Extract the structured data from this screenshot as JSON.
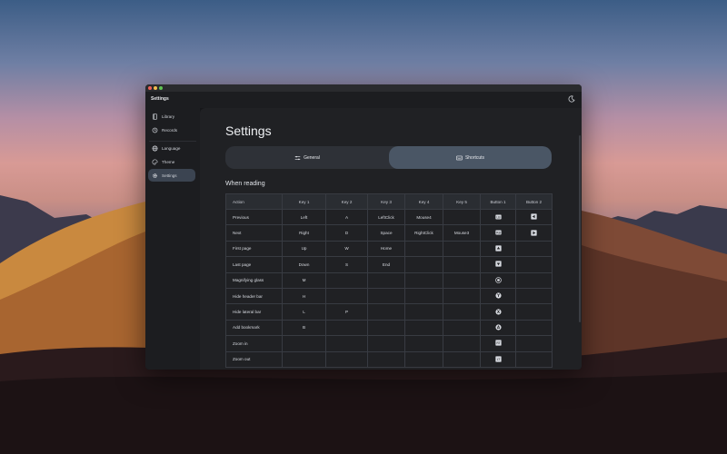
{
  "window": {
    "app_title": "Settings"
  },
  "sidebar": {
    "items": [
      {
        "label": "Library",
        "icon": "book-icon"
      },
      {
        "label": "Records",
        "icon": "history-icon"
      },
      {
        "label": "Language",
        "icon": "globe-icon"
      },
      {
        "label": "Theme",
        "icon": "palette-icon"
      },
      {
        "label": "Settings",
        "icon": "gear-icon",
        "active": true
      }
    ]
  },
  "main": {
    "page_title": "Settings",
    "tabs": [
      {
        "label": "General",
        "icon": "sliders-icon"
      },
      {
        "label": "Shortcuts",
        "icon": "keyboard-icon",
        "active": true
      }
    ],
    "section_title": "When reading",
    "table": {
      "headers": [
        "Action",
        "Key 1",
        "Key 2",
        "Key 3",
        "Key 4",
        "Key 5",
        "Button 1",
        "Button 2"
      ],
      "rows": [
        {
          "action": "Previous",
          "key1": "Left",
          "key2": "A",
          "key3": "LeftClick",
          "key4": "Mouse4",
          "key5": "",
          "button1": "LB",
          "button2": "dpad-left"
        },
        {
          "action": "Next",
          "key1": "Right",
          "key2": "D",
          "key3": "Space",
          "key4": "RightClick",
          "key5": "Mouse3",
          "button1": "RB",
          "button2": "dpad-right"
        },
        {
          "action": "First page",
          "key1": "Up",
          "key2": "W",
          "key3": "Home",
          "key4": "",
          "key5": "",
          "button1": "dpad-up",
          "button2": ""
        },
        {
          "action": "Last page",
          "key1": "Down",
          "key2": "S",
          "key3": "End",
          "key4": "",
          "key5": "",
          "button1": "dpad-down",
          "button2": ""
        },
        {
          "action": "Magnifying glass",
          "key1": "M",
          "key2": "",
          "key3": "",
          "key4": "",
          "key5": "",
          "button1": "stick",
          "button2": ""
        },
        {
          "action": "Hide header bar",
          "key1": "H",
          "key2": "",
          "key3": "",
          "key4": "",
          "key5": "",
          "button1": "Y",
          "button2": ""
        },
        {
          "action": "Hide lateral bar",
          "key1": "L",
          "key2": "P",
          "key3": "",
          "key4": "",
          "key5": "",
          "button1": "X",
          "button2": ""
        },
        {
          "action": "Add bookmark",
          "key1": "B",
          "key2": "",
          "key3": "",
          "key4": "",
          "key5": "",
          "button1": "A",
          "button2": ""
        },
        {
          "action": "Zoom in",
          "key1": "",
          "key2": "",
          "key3": "",
          "key4": "",
          "key5": "",
          "button1": "RT",
          "button2": ""
        },
        {
          "action": "Zoom out",
          "key1": "",
          "key2": "",
          "key3": "",
          "key4": "",
          "key5": "",
          "button1": "LT",
          "button2": ""
        }
      ]
    }
  }
}
